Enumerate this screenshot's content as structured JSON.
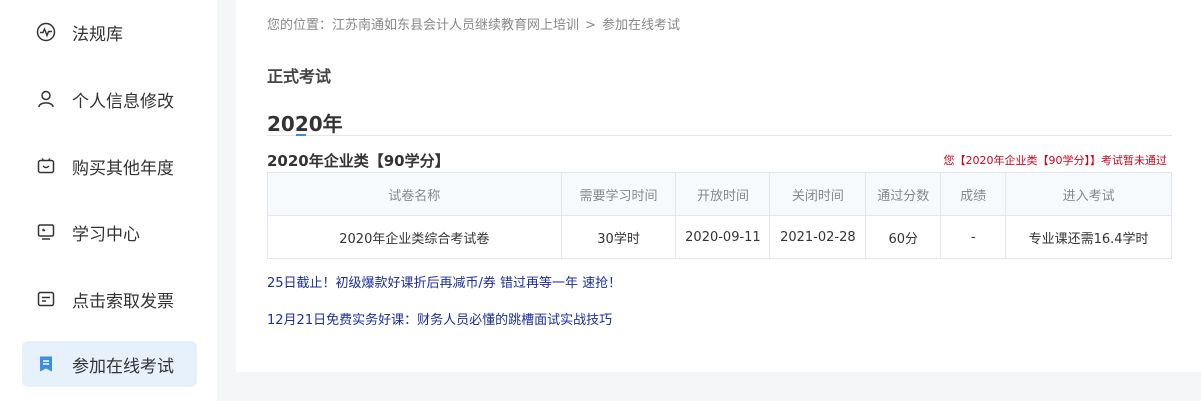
{
  "sidebar": {
    "items": [
      {
        "label": "法规库",
        "icon": "pulse-icon"
      },
      {
        "label": "个人信息修改",
        "icon": "user-icon"
      },
      {
        "label": "购买其他年度",
        "icon": "cart-icon"
      },
      {
        "label": "学习中心",
        "icon": "monitor-icon"
      },
      {
        "label": "点击索取发票",
        "icon": "invoice-icon"
      },
      {
        "label": "参加在线考试",
        "icon": "exam-icon",
        "active": true
      }
    ]
  },
  "breadcrumb": {
    "prefix": "您的位置：",
    "parent": "江苏南通如东县会计人员继续教育网上培训",
    "separator": ">",
    "current": "参加在线考试"
  },
  "page_title": "正式考试",
  "year_heading": "2020年",
  "category": {
    "title": "2020年企业类【90学分】",
    "status_notice": "您【2020年企业类【90学分】】考试暂未通过"
  },
  "table": {
    "headers": [
      "试卷名称",
      "需要学习时间",
      "开放时间",
      "关闭时间",
      "通过分数",
      "成绩",
      "进入考试"
    ],
    "rows": [
      [
        "2020年企业类综合考试卷",
        "30学时",
        "2020-09-11",
        "2021-02-28",
        "60分",
        "-",
        "专业课还需16.4学时"
      ]
    ]
  },
  "promos": [
    "25日截止！初级爆款好课折后再减币/券 错过再等一年 速抢！",
    "12月21日免费实务好课：财务人员必懂的跳槽面试实战技巧"
  ],
  "colors": {
    "accent": "#3a8ee6",
    "active_bg": "#e7f1fc",
    "notice_red": "#d0021b",
    "promo_blue": "#1a2fa0"
  }
}
